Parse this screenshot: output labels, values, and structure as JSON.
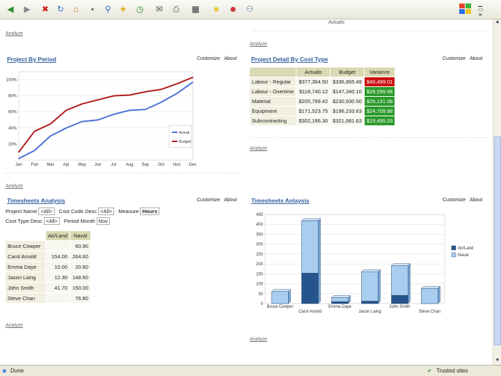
{
  "browser": {
    "toolbar_icons": [
      "back-icon",
      "forward-icon",
      "stop-icon",
      "refresh-icon",
      "home-icon",
      "search-icon",
      "favorites-icon",
      "history-icon",
      "mail-icon",
      "print-icon",
      "edit-icon",
      "discuss-icon",
      "messenger-icon",
      "users-icon"
    ],
    "status_left": "Done",
    "status_right": "Trusted sites",
    "top_cut_text": "Actuals"
  },
  "links": {
    "analyze": "Analyze",
    "customize": "Customize",
    "about": "About"
  },
  "panel_project_by_period": {
    "title": "Project By Period",
    "chart_data": {
      "type": "line",
      "categories": [
        "Jan",
        "Feb",
        "Mar",
        "Apr",
        "May",
        "Jun",
        "Jul",
        "Aug",
        "Sep",
        "Oct",
        "Nov",
        "Dec"
      ],
      "ytick_labels": [
        "20%",
        "40%",
        "60%",
        "80%",
        "100%"
      ],
      "ylim": [
        0,
        110
      ],
      "series": [
        {
          "name": "Actual",
          "color": "#4a6fd6",
          "values": [
            2,
            12,
            30,
            40,
            48,
            50,
            57,
            62,
            63,
            72,
            83,
            97
          ]
        },
        {
          "name": "Budget",
          "color": "#b01818",
          "values": [
            10,
            36,
            45,
            62,
            70,
            75,
            80,
            81,
            85,
            88,
            95,
            103
          ]
        }
      ]
    }
  },
  "panel_cost_type": {
    "title": "Project Detail By Cost Type",
    "headers": [
      "",
      "Actuals",
      "Budget",
      "Variance"
    ],
    "rows": [
      {
        "label": "Labour - Regular",
        "actual": "$377,364.50",
        "budget": "$336,865.49",
        "variance": "$40,499.01",
        "status": "red"
      },
      {
        "label": "Labour - Overtime",
        "actual": "$118,740.12",
        "budget": "$147,340.10",
        "variance": "$28,599.98",
        "status": "green"
      },
      {
        "label": "Material",
        "actual": "$205,799.42",
        "budget": "$230,930.50",
        "variance": "$25,131.08",
        "status": "green"
      },
      {
        "label": "Equipment",
        "actual": "$171,523.75",
        "budget": "$196,233.63",
        "variance": "$24,709.88",
        "status": "green"
      },
      {
        "label": "Subcontracting",
        "actual": "$302,186.30",
        "budget": "$321,681.63",
        "variance": "$19,495.33",
        "status": "green"
      }
    ]
  },
  "panel_timesheets_table": {
    "title": "Timesheets Analysis",
    "filters": [
      {
        "label": "Project Name",
        "value": "<All>"
      },
      {
        "label": "Cost Code Desc",
        "value": "<All>"
      },
      {
        "label": "Measure",
        "value": "Hours"
      }
    ],
    "filters2": [
      {
        "label": "Cost Type Desc",
        "value": "<All>"
      },
      {
        "label": "Period Month",
        "value": "Nov"
      }
    ],
    "headers": [
      "",
      "Air/Land",
      "Naval"
    ],
    "rows": [
      {
        "name": "Bruce Cowper",
        "air": "",
        "naval": "60.90"
      },
      {
        "name": "Carol Arnold",
        "air": "154.00",
        "naval": "264.60"
      },
      {
        "name": "Emma Daye",
        "air": "10.00",
        "naval": "20.60"
      },
      {
        "name": "Jason Laing",
        "air": "12.30",
        "naval": "148.60"
      },
      {
        "name": "John Smith",
        "air": "41.70",
        "naval": "150.00"
      },
      {
        "name": "Steve Chan",
        "air": "",
        "naval": "76.80"
      }
    ]
  },
  "panel_timesheets_chart": {
    "title": "Timesheets Anlaysis",
    "chart_data": {
      "type": "bar",
      "stacked": true,
      "categories": [
        "Bruce Cowper",
        "Carol Arnold",
        "Emma Daye",
        "Jason Laing",
        "John Smith",
        "Steve Chan"
      ],
      "ylim": [
        0,
        450
      ],
      "yticks": [
        0,
        50,
        100,
        150,
        200,
        250,
        300,
        350,
        400,
        450
      ],
      "series": [
        {
          "name": "Air/Land",
          "color": "#25558c",
          "values": [
            0,
            154.0,
            10.0,
            12.3,
            41.7,
            0
          ]
        },
        {
          "name": "Naval",
          "color": "#a9cdee",
          "values": [
            60.9,
            264.6,
            20.6,
            148.6,
            150.0,
            76.8
          ]
        }
      ]
    }
  }
}
